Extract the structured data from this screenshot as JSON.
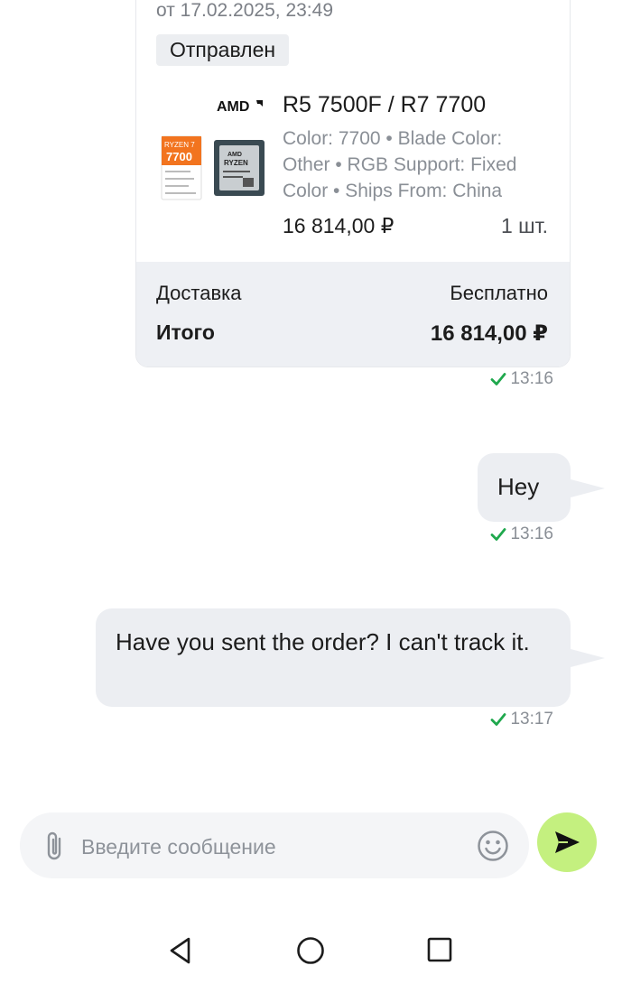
{
  "order": {
    "date": "от 17.02.2025, 23:49",
    "status": "Отправлен",
    "product": {
      "name": "R5  7500F / R7 7700",
      "attributes": "Color: 7700 • Blade Color: Other • RGB Support: Fixed Color • Ships From: China",
      "price": "16 814,00 ₽",
      "quantity": "1 шт.",
      "image": {
        "brand": "AMD",
        "box_line": "RYZEN 7",
        "box_model": "7700",
        "chip_brand": "AMD",
        "chip_name": "RYZEN"
      }
    },
    "delivery_label": "Доставка",
    "delivery_value": "Бесплатно",
    "total_label": "Итого",
    "total_value": "16 814,00 ₽",
    "time": "13:16"
  },
  "messages": [
    {
      "text": "Hey",
      "time": "13:16"
    },
    {
      "text": "Have you sent the order? I can't track it.",
      "time": "13:17"
    }
  ],
  "composer": {
    "placeholder": "Введите сообщение",
    "attach_icon": "paperclip-icon",
    "emoji_icon": "smiley-icon",
    "send_icon": "send-arrow-icon"
  },
  "nav": {
    "back_icon": "back-triangle-icon",
    "home_icon": "home-circle-icon",
    "recents_icon": "recents-square-icon"
  },
  "colors": {
    "bubble": "#eceef2",
    "send_button": "#c4f07f",
    "check": "#1fa84d",
    "summary_bg": "#eef0f4",
    "muted_text": "#8a8f96"
  }
}
